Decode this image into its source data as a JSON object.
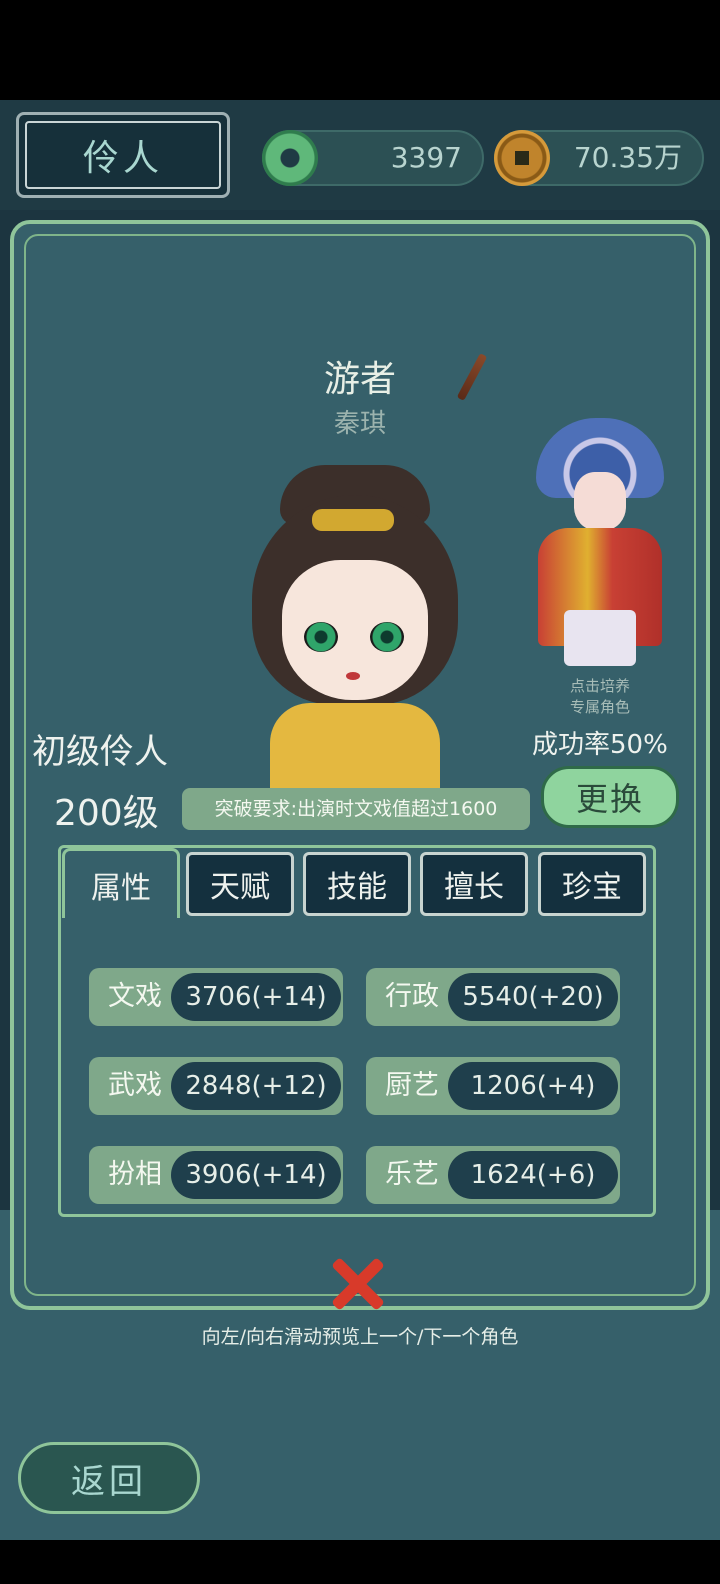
{
  "header": {
    "title": "伶人",
    "jade_amount": "3397",
    "coin_amount": "70.35万"
  },
  "character": {
    "title": "游者",
    "name": "秦琪",
    "rank": "初级伶人",
    "level": "200级",
    "breakthrough": "突破要求:出演时文戏值超过1600",
    "success_rate": "成功率50%",
    "change_label": "更换",
    "exclusive_hint_1": "点击培养",
    "exclusive_hint_2": "专属角色"
  },
  "tabs": [
    "属性",
    "天赋",
    "技能",
    "擅长",
    "珍宝"
  ],
  "stats": [
    {
      "label": "文戏",
      "value": "3706(+14)"
    },
    {
      "label": "行政",
      "value": "5540(+20)"
    },
    {
      "label": "武戏",
      "value": "2848(+12)"
    },
    {
      "label": "厨艺",
      "value": "1206(+4)"
    },
    {
      "label": "扮相",
      "value": "3906(+14)"
    },
    {
      "label": "乐艺",
      "value": "1624(+6)"
    }
  ],
  "footer": {
    "swipe_hint": "向左/向右滑动预览上一个/下一个角色",
    "back_label": "返回"
  },
  "colors": {
    "background": "#1f3a44",
    "panel": "#36606a",
    "accent_green": "#8fc59a",
    "close_red": "#d83a2a"
  }
}
